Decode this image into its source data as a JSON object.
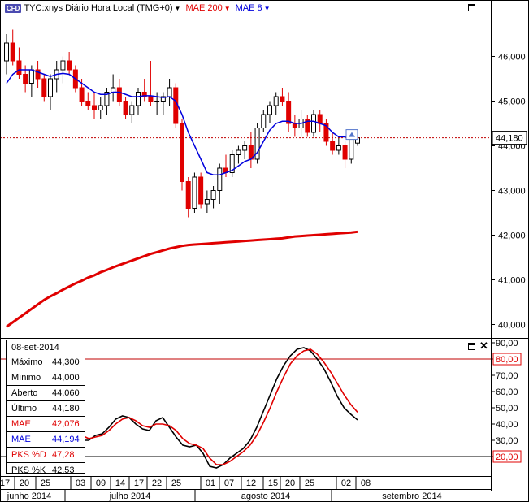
{
  "header": {
    "badge": "CFD",
    "symbol_label": "TYC:xnys Diário Hora Local (TMG+0)",
    "indicator1": "MAE 200",
    "indicator2": "MAE 8",
    "colors": {
      "indicator1": "#e00000",
      "indicator2": "#0000dd"
    }
  },
  "info_panel": {
    "date": "08-set-2014",
    "rows": [
      {
        "label": "Máximo",
        "value": "44,300",
        "color": "#000000"
      },
      {
        "label": "Mínimo",
        "value": "44,000",
        "color": "#000000"
      },
      {
        "label": "Aberto",
        "value": "44,060",
        "color": "#000000"
      },
      {
        "label": "Último",
        "value": "44,180",
        "color": "#000000"
      },
      {
        "label": "MAE",
        "value": "42,076",
        "color": "#e00000"
      },
      {
        "label": "MAE",
        "value": "44,194",
        "color": "#0000dd"
      },
      {
        "label": "PKS %D",
        "value": "47,28",
        "color": "#e00000"
      },
      {
        "label": "PKS %K",
        "value": "42,53",
        "color": "#000000"
      }
    ]
  },
  "chart_data": [
    {
      "type": "candlestick",
      "ylim": [
        39.7,
        46.9
      ],
      "yticks": [
        "40,000",
        "41,000",
        "42,000",
        "43,000",
        "44,000",
        "45,000",
        "46,000"
      ],
      "last_price_label": "44,180",
      "last_price": 44.18,
      "up_color": "#000000",
      "down_color": "#e00000",
      "candles": [
        [
          45.9,
          46.5,
          45.6,
          46.3
        ],
        [
          46.3,
          46.6,
          45.8,
          45.9
        ],
        [
          45.9,
          46.2,
          45.5,
          45.6
        ],
        [
          45.6,
          45.8,
          45.2,
          45.4
        ],
        [
          45.4,
          45.8,
          45.1,
          45.7
        ],
        [
          45.7,
          45.9,
          45.3,
          45.5
        ],
        [
          45.5,
          45.6,
          45.0,
          45.1
        ],
        [
          45.1,
          45.6,
          44.8,
          45.5
        ],
        [
          45.5,
          45.9,
          45.2,
          45.7
        ],
        [
          45.7,
          46.0,
          45.4,
          45.9
        ],
        [
          45.9,
          46.1,
          45.6,
          45.7
        ],
        [
          45.7,
          45.8,
          45.2,
          45.3
        ],
        [
          45.3,
          45.5,
          44.9,
          45.0
        ],
        [
          45.0,
          45.2,
          44.8,
          44.9
        ],
        [
          44.9,
          45.2,
          44.6,
          44.8
        ],
        [
          44.8,
          45.1,
          44.6,
          44.9
        ],
        [
          44.9,
          45.3,
          44.7,
          45.2
        ],
        [
          45.2,
          45.6,
          45.0,
          45.3
        ],
        [
          45.3,
          45.5,
          44.9,
          45.0
        ],
        [
          45.0,
          45.1,
          44.6,
          44.7
        ],
        [
          44.7,
          45.0,
          44.5,
          44.9
        ],
        [
          44.9,
          45.3,
          44.7,
          45.2
        ],
        [
          45.2,
          45.5,
          45.0,
          45.1
        ],
        [
          45.1,
          45.9,
          44.9,
          45.0
        ],
        [
          45.0,
          45.2,
          44.7,
          45.0
        ],
        [
          45.0,
          45.2,
          44.7,
          45.1
        ],
        [
          45.1,
          45.5,
          44.9,
          45.3
        ],
        [
          45.3,
          45.4,
          44.4,
          44.5
        ],
        [
          44.5,
          44.6,
          43.0,
          43.2
        ],
        [
          43.2,
          43.3,
          42.4,
          42.6
        ],
        [
          42.6,
          43.4,
          42.5,
          43.3
        ],
        [
          43.3,
          43.4,
          42.6,
          42.7
        ],
        [
          42.7,
          43.0,
          42.5,
          42.8
        ],
        [
          42.8,
          43.1,
          42.6,
          43.0
        ],
        [
          43.0,
          43.6,
          42.7,
          43.5
        ],
        [
          43.5,
          43.8,
          43.3,
          43.4
        ],
        [
          43.4,
          43.9,
          43.3,
          43.8
        ],
        [
          43.8,
          44.0,
          43.6,
          43.9
        ],
        [
          43.9,
          44.1,
          43.7,
          44.0
        ],
        [
          44.0,
          44.3,
          43.5,
          43.7
        ],
        [
          43.7,
          44.5,
          43.6,
          44.4
        ],
        [
          44.4,
          44.8,
          44.3,
          44.7
        ],
        [
          44.7,
          45.0,
          44.5,
          44.9
        ],
        [
          44.9,
          45.2,
          44.7,
          45.1
        ],
        [
          45.1,
          45.3,
          44.9,
          45.0
        ],
        [
          45.0,
          45.2,
          44.3,
          44.5
        ],
        [
          44.5,
          44.7,
          44.2,
          44.4
        ],
        [
          44.4,
          44.8,
          44.2,
          44.6
        ],
        [
          44.6,
          44.7,
          44.2,
          44.3
        ],
        [
          44.3,
          44.8,
          44.2,
          44.7
        ],
        [
          44.7,
          44.8,
          44.3,
          44.5
        ],
        [
          44.5,
          44.6,
          44.0,
          44.1
        ],
        [
          44.1,
          44.3,
          43.8,
          43.9
        ],
        [
          43.9,
          44.2,
          43.8,
          44.0
        ],
        [
          44.0,
          44.1,
          43.5,
          43.7
        ],
        [
          43.7,
          44.3,
          43.6,
          44.2
        ],
        [
          44.06,
          44.3,
          44.0,
          44.18
        ]
      ],
      "mae8": [
        45.4,
        45.6,
        45.7,
        45.7,
        45.7,
        45.65,
        45.6,
        45.55,
        45.6,
        45.62,
        45.6,
        45.5,
        45.4,
        45.3,
        45.2,
        45.15,
        45.15,
        45.2,
        45.2,
        45.15,
        45.1,
        45.1,
        45.12,
        45.12,
        45.1,
        45.08,
        45.1,
        45.0,
        44.7,
        44.3,
        44.0,
        43.7,
        43.4,
        43.35,
        43.35,
        43.4,
        43.45,
        43.55,
        43.65,
        43.7,
        43.85,
        44.1,
        44.35,
        44.5,
        44.55,
        44.55,
        44.5,
        44.5,
        44.55,
        44.55,
        44.5,
        44.45,
        44.3,
        44.2,
        44.2,
        44.19,
        44.194
      ],
      "mae200": [
        39.95,
        40.05,
        40.15,
        40.25,
        40.35,
        40.45,
        40.55,
        40.63,
        40.7,
        40.78,
        40.85,
        40.92,
        40.98,
        41.05,
        41.1,
        41.17,
        41.22,
        41.28,
        41.33,
        41.38,
        41.43,
        41.48,
        41.53,
        41.58,
        41.62,
        41.66,
        41.7,
        41.73,
        41.76,
        41.78,
        41.79,
        41.8,
        41.81,
        41.82,
        41.83,
        41.84,
        41.85,
        41.86,
        41.87,
        41.88,
        41.89,
        41.9,
        41.91,
        41.92,
        41.93,
        41.95,
        41.97,
        41.98,
        41.99,
        42.0,
        42.01,
        42.02,
        42.03,
        42.04,
        42.05,
        42.06,
        42.076
      ]
    },
    {
      "type": "line",
      "ylim": [
        8,
        92
      ],
      "yticks": [
        "20,00",
        "30,00",
        "40,00",
        "50,00",
        "60,00",
        "70,00",
        "80,00",
        "90,00"
      ],
      "overbought": 80,
      "oversold": 20,
      "overbought_label": "80,00",
      "oversold_label": "20,00",
      "series": [
        {
          "color": "#000000",
          "values": [
            72,
            68,
            64,
            60,
            55,
            50,
            46,
            43,
            40,
            36,
            32,
            30,
            30,
            33,
            34,
            38,
            43,
            45,
            44,
            40,
            37,
            36,
            42,
            44,
            38,
            32,
            27,
            26,
            27,
            22,
            14,
            13,
            15,
            19,
            22,
            25,
            30,
            38,
            48,
            58,
            68,
            76,
            82,
            86,
            87,
            85,
            80,
            74,
            66,
            57,
            50,
            46,
            42.53
          ]
        },
        {
          "color": "#e00000",
          "values": [
            70,
            68,
            65,
            62,
            58,
            54,
            50,
            46,
            43,
            40,
            36,
            33,
            31,
            32,
            33,
            36,
            40,
            43,
            44,
            42,
            39,
            38,
            40,
            40,
            39,
            36,
            31,
            28,
            27,
            25,
            19,
            15,
            15,
            17,
            20,
            23,
            27,
            33,
            41,
            50,
            60,
            69,
            77,
            82,
            85,
            86,
            83,
            78,
            72,
            65,
            58,
            52,
            47.28
          ]
        }
      ]
    }
  ],
  "x_axis": {
    "day_ticks": [
      "17",
      "20",
      "25",
      "03",
      "09",
      "14",
      "17",
      "22",
      "25",
      "01",
      "07",
      "12",
      "15",
      "20",
      "25",
      "02",
      "08"
    ],
    "month_labels": [
      "junho 2014",
      "julho 2014",
      "agosto 2014",
      "setembro 2014"
    ]
  }
}
